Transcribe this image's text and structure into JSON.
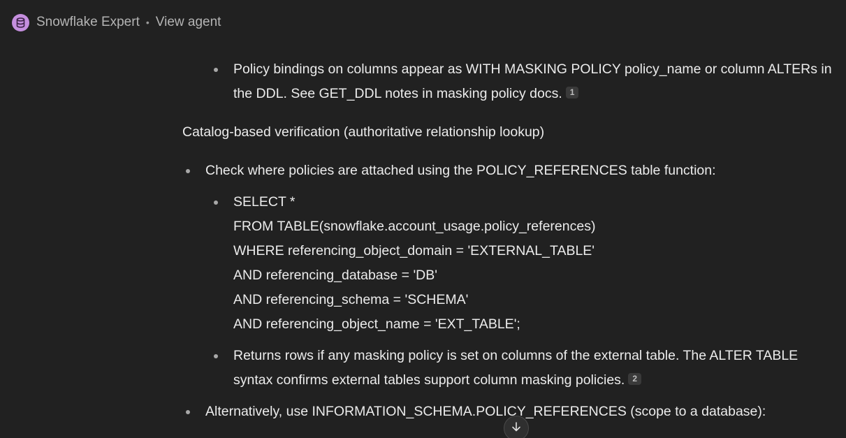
{
  "header": {
    "agent_name": "Snowflake Expert",
    "separator": "•",
    "view_agent_label": "View agent",
    "avatar_icon": "database-icon",
    "avatar_color": "#c58fde"
  },
  "content": {
    "top_bullet": {
      "text": "Policy bindings on columns appear as WITH MASKING POLICY policy_name or column ALTERs in the DDL. See GET_DDL notes in masking policy docs.",
      "citation": "1"
    },
    "section_heading": "Catalog-based verification (authoritative relationship lookup)",
    "bullet_1": {
      "text": "Check where policies are attached using the POLICY_REFERENCES table function:",
      "code_lines": [
        "SELECT *",
        "FROM TABLE(snowflake.account_usage.policy_references)",
        "WHERE referencing_object_domain = 'EXTERNAL_TABLE'",
        "AND referencing_database = 'DB'",
        "AND referencing_schema = 'SCHEMA'",
        "AND referencing_object_name = 'EXT_TABLE';"
      ],
      "sub_bullet": {
        "text": "Returns rows if any masking policy is set on columns of the external table. The ALTER TABLE syntax confirms external tables support column masking policies.",
        "citation": "2"
      }
    },
    "bullet_2": {
      "text": "Alternatively, use INFORMATION_SCHEMA.POLICY_REFERENCES (scope to a database):"
    }
  },
  "scroll_button": {
    "icon": "arrow-down-icon"
  }
}
